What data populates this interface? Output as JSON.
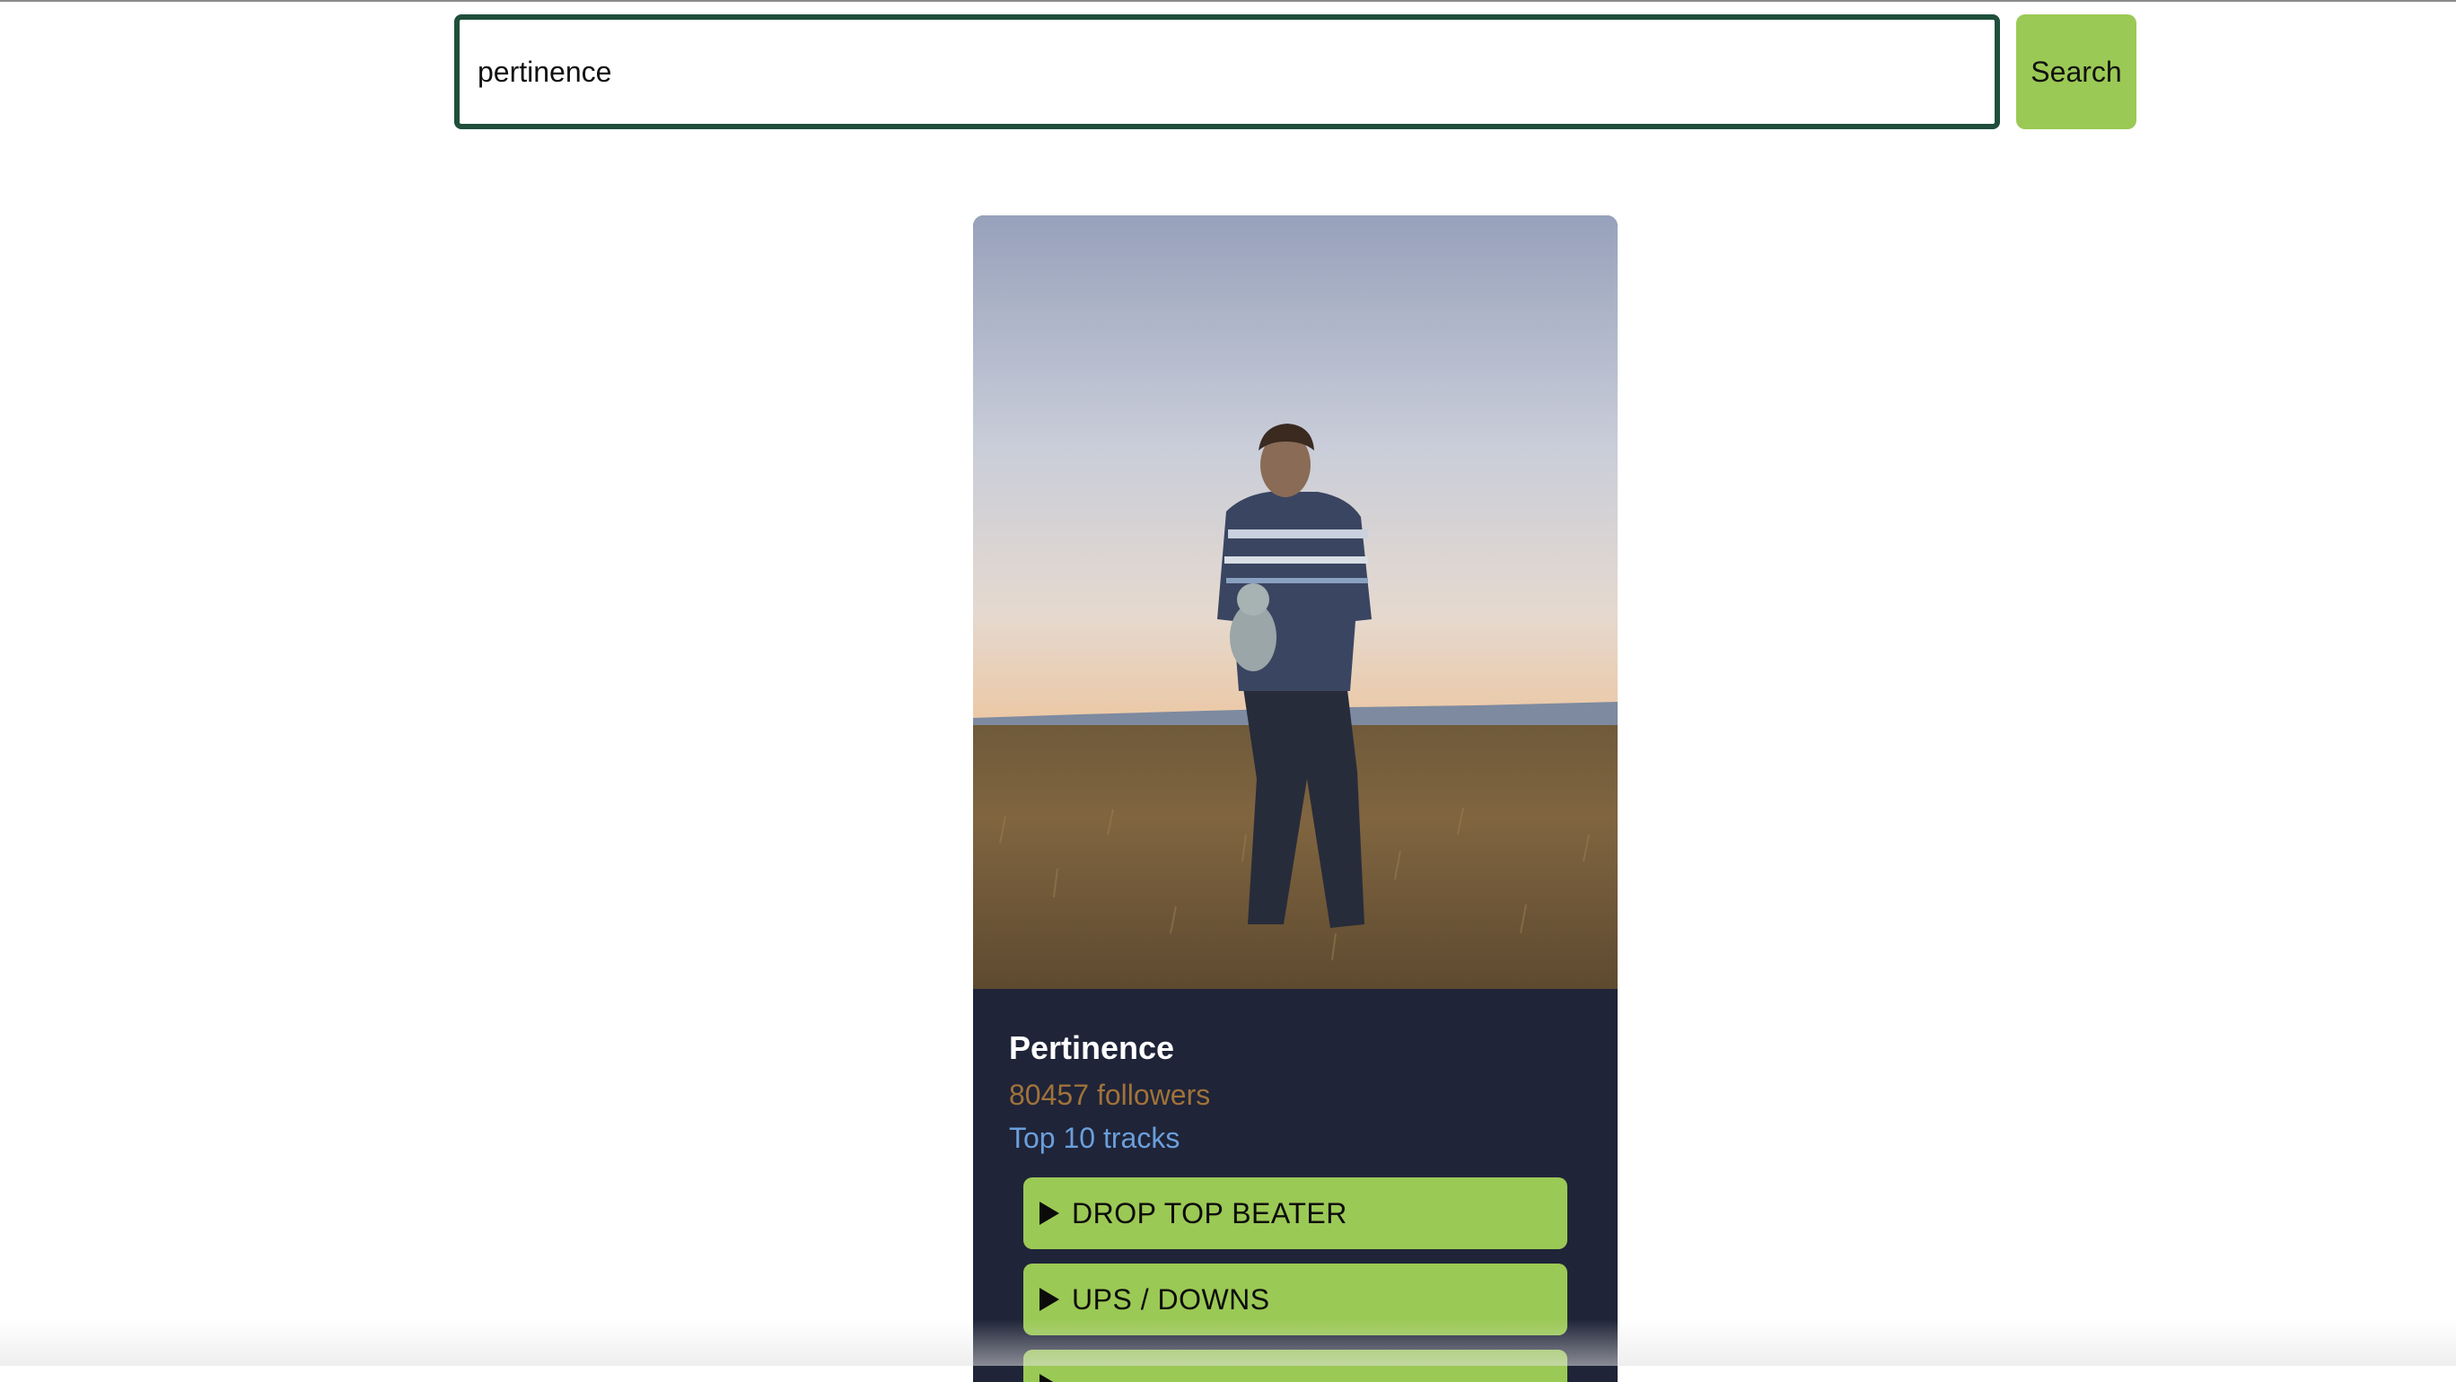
{
  "search": {
    "value": "pertinence",
    "button_label": "Search"
  },
  "artist": {
    "photo_icon": "artist-photo",
    "name": "Pertinence",
    "followers_count": "80457",
    "followers_label": "followers",
    "top_tracks_label": "Top 10 tracks",
    "tracks": [
      {
        "title": "DROP TOP BEATER",
        "icon": "play-icon"
      },
      {
        "title": "UPS / DOWNS",
        "icon": "play-icon"
      },
      {
        "title": "",
        "icon": "play-icon"
      }
    ]
  },
  "colors": {
    "accent_green": "#9bc955",
    "input_border": "#1f4f3b",
    "card_background": "#1f2438",
    "followers_text": "#a0723a",
    "tracks_link": "#6b9fdc"
  }
}
